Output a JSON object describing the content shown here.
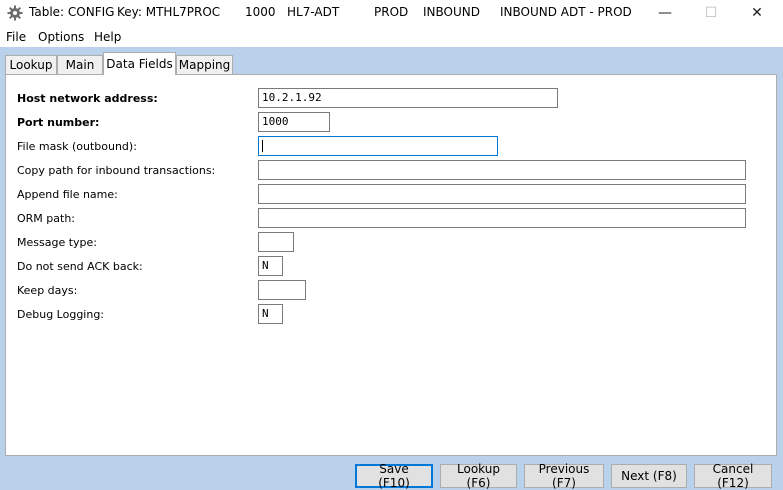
{
  "titlebar": {
    "table": "Table: CONFIG",
    "key": "Key: MTHL7PROC",
    "code": "1000",
    "interface": "HL7-ADT",
    "env": "PROD",
    "direction": "INBOUND",
    "description": "INBOUND ADT - PROD",
    "minimize": "—",
    "maximize": "☐",
    "close": "✕"
  },
  "menu": {
    "file": "File",
    "options": "Options",
    "help": "Help"
  },
  "tabs": {
    "lookup": "Lookup",
    "main": "Main",
    "data_fields": "Data Fields",
    "mapping": "Mapping",
    "active": "Data Fields"
  },
  "fields": {
    "host_label": "Host network address:",
    "host_value": "10.2.1.92",
    "port_label": "Port number:",
    "port_value": "1000",
    "file_mask_label": "File mask (outbound):",
    "file_mask_value": "",
    "copy_path_label": "Copy path for inbound transactions:",
    "copy_path_value": "",
    "append_label": "Append file name:",
    "append_value": "",
    "orm_label": "ORM path:",
    "orm_value": "",
    "msg_type_label": "Message type:",
    "msg_type_value": "",
    "ack_label": "Do not send ACK back:",
    "ack_value": "N",
    "keep_days_label": "Keep days:",
    "keep_days_value": "",
    "debug_label": "Debug Logging:",
    "debug_value": "N"
  },
  "buttons": {
    "save": "Save (F10)",
    "lookup": "Lookup (F6)",
    "previous": "Previous (F7)",
    "next": "Next (F8)",
    "cancel": "Cancel (F12)"
  },
  "colors": {
    "frame": "#b9d1ea",
    "focus": "#0078d7"
  }
}
